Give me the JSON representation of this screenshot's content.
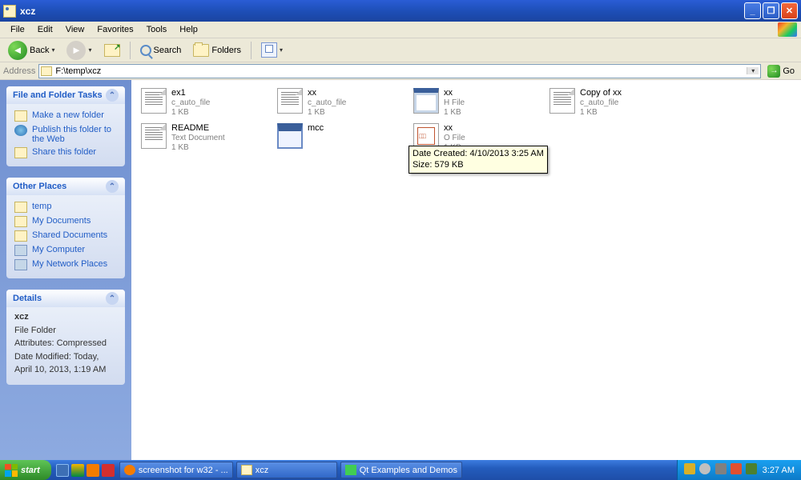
{
  "window": {
    "title": "xcz"
  },
  "menubar": [
    "File",
    "Edit",
    "View",
    "Favorites",
    "Tools",
    "Help"
  ],
  "toolbar": {
    "back": "Back",
    "search": "Search",
    "folders": "Folders"
  },
  "addressbar": {
    "label": "Address",
    "path": "F:\\temp\\xcz",
    "go": "Go"
  },
  "sidebar": {
    "section1": {
      "title": "File and Folder Tasks",
      "items": [
        "Make a new folder",
        "Publish this folder to the Web",
        "Share this folder"
      ]
    },
    "section2": {
      "title": "Other Places",
      "items": [
        "temp",
        "My Documents",
        "Shared Documents",
        "My Computer",
        "My Network Places"
      ]
    },
    "section3": {
      "title": "Details",
      "name": "xcz",
      "kind": "File Folder",
      "attr": "Attributes: Compressed",
      "date": "Date Modified: Today, April 10, 2013, 1:19 AM"
    }
  },
  "files": [
    {
      "name": "ex1",
      "type": "c_auto_file",
      "size": "1 KB",
      "icon": "txt"
    },
    {
      "name": "xx",
      "type": "c_auto_file",
      "size": "1 KB",
      "icon": "txt"
    },
    {
      "name": "xx",
      "type": "H File",
      "size": "1 KB",
      "icon": "page"
    },
    {
      "name": "Copy of xx",
      "type": "c_auto_file",
      "size": "1 KB",
      "icon": "txt"
    },
    {
      "name": "README",
      "type": "Text Document",
      "size": "1 KB",
      "icon": "txt"
    },
    {
      "name": "mcc",
      "type": "",
      "size": "",
      "icon": "exe"
    },
    {
      "name": "xx",
      "type": "O File",
      "size": "1 KB",
      "icon": "o"
    }
  ],
  "tooltip": {
    "line1": "Date Created: 4/10/2013 3:25 AM",
    "line2": "Size: 579 KB"
  },
  "taskbar": {
    "start": "start",
    "items": [
      "screenshot for w32 - ...",
      "xcz",
      "Qt Examples and Demos"
    ],
    "clock": "3:27 AM"
  }
}
